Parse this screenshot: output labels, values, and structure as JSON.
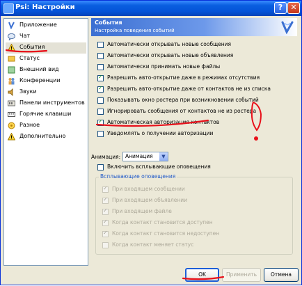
{
  "window": {
    "title": "Psi: Настройки",
    "help_label": "?",
    "close_label": "✕"
  },
  "sidebar": {
    "items": [
      {
        "label": "Приложение",
        "icon": "psi-icon"
      },
      {
        "label": "Чат",
        "icon": "chat-bubble-icon"
      },
      {
        "label": "События",
        "icon": "warning-icon",
        "selected": true
      },
      {
        "label": "Статус",
        "icon": "status-icon"
      },
      {
        "label": "Внешний вид",
        "icon": "appearance-icon"
      },
      {
        "label": "Конференции",
        "icon": "conference-icon"
      },
      {
        "label": "Звуки",
        "icon": "sound-icon"
      },
      {
        "label": "Панели инструментов",
        "icon": "toolbar-icon"
      },
      {
        "label": "Горячие клавиши",
        "icon": "hotkeys-icon"
      },
      {
        "label": "Разное",
        "icon": "misc-icon"
      },
      {
        "label": "Дополнительно",
        "icon": "advanced-icon"
      }
    ]
  },
  "header": {
    "title": "События",
    "subtitle": "Настройка поведения событий"
  },
  "options": [
    {
      "label": "Автоматически открывать новые сообщения",
      "checked": false
    },
    {
      "label": "Автоматически открывать новые объявления",
      "checked": false
    },
    {
      "label": "Автоматически принимать новые файлы",
      "checked": false
    },
    {
      "label": "Разрешить авто-открытие даже в режимах отсутствия",
      "checked": true
    },
    {
      "label": "Разрешить авто-открытие даже от контактов не из списка",
      "checked": true
    },
    {
      "label": "Показывать окно ростера при возникновении событий",
      "checked": false
    },
    {
      "label": "Игнорировать сообщения от контактов не из ростера",
      "checked": false
    },
    {
      "label": "Автоматическая авторизация контактов",
      "checked": true
    },
    {
      "label": "Уведомлять о получении авторизации",
      "checked": false
    }
  ],
  "animation": {
    "label": "Анимация:",
    "value": "Анимация"
  },
  "popup_toggle": {
    "label": "Включить всплывающие оповещения",
    "checked": false
  },
  "popup_group": {
    "title": "Всплывающие оповещения",
    "items": [
      {
        "label": "При входящем сообщении",
        "checked": true
      },
      {
        "label": "При входящем объявлении",
        "checked": true
      },
      {
        "label": "При входящем файле",
        "checked": true
      },
      {
        "label": "Когда контакт становится доступен",
        "checked": true
      },
      {
        "label": "Когда контакт становится недоступен",
        "checked": true
      },
      {
        "label": "Когда контакт меняет статус",
        "checked": false
      }
    ]
  },
  "buttons": {
    "ok": "OK",
    "apply": "Применить",
    "cancel": "Отмена"
  },
  "colors": {
    "annotation_red": "#e8101a",
    "header_blue": "#3b6fd2",
    "titlebar_blue": "#0453d8"
  }
}
